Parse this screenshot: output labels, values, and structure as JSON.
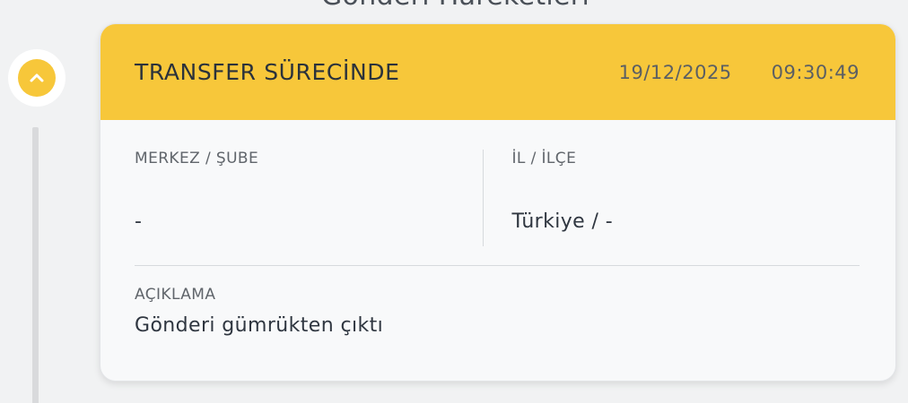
{
  "section": {
    "title": "Gönderi Hareketleri"
  },
  "timeline": {
    "toggle_icon": "chevron-up-icon",
    "accent_color": "#f7c73a"
  },
  "card": {
    "status": "TRANSFER SÜRECİNDE",
    "date": "19/12/2025",
    "time": "09:30:49",
    "fields": {
      "branch_label": "MERKEZ / ŞUBE",
      "branch_value": "-",
      "location_label": "İL / İLÇE",
      "location_value": "Türkiye / -",
      "description_label": "AÇIKLAMA",
      "description_value": "Gönderi gümrükten çıktı"
    }
  }
}
